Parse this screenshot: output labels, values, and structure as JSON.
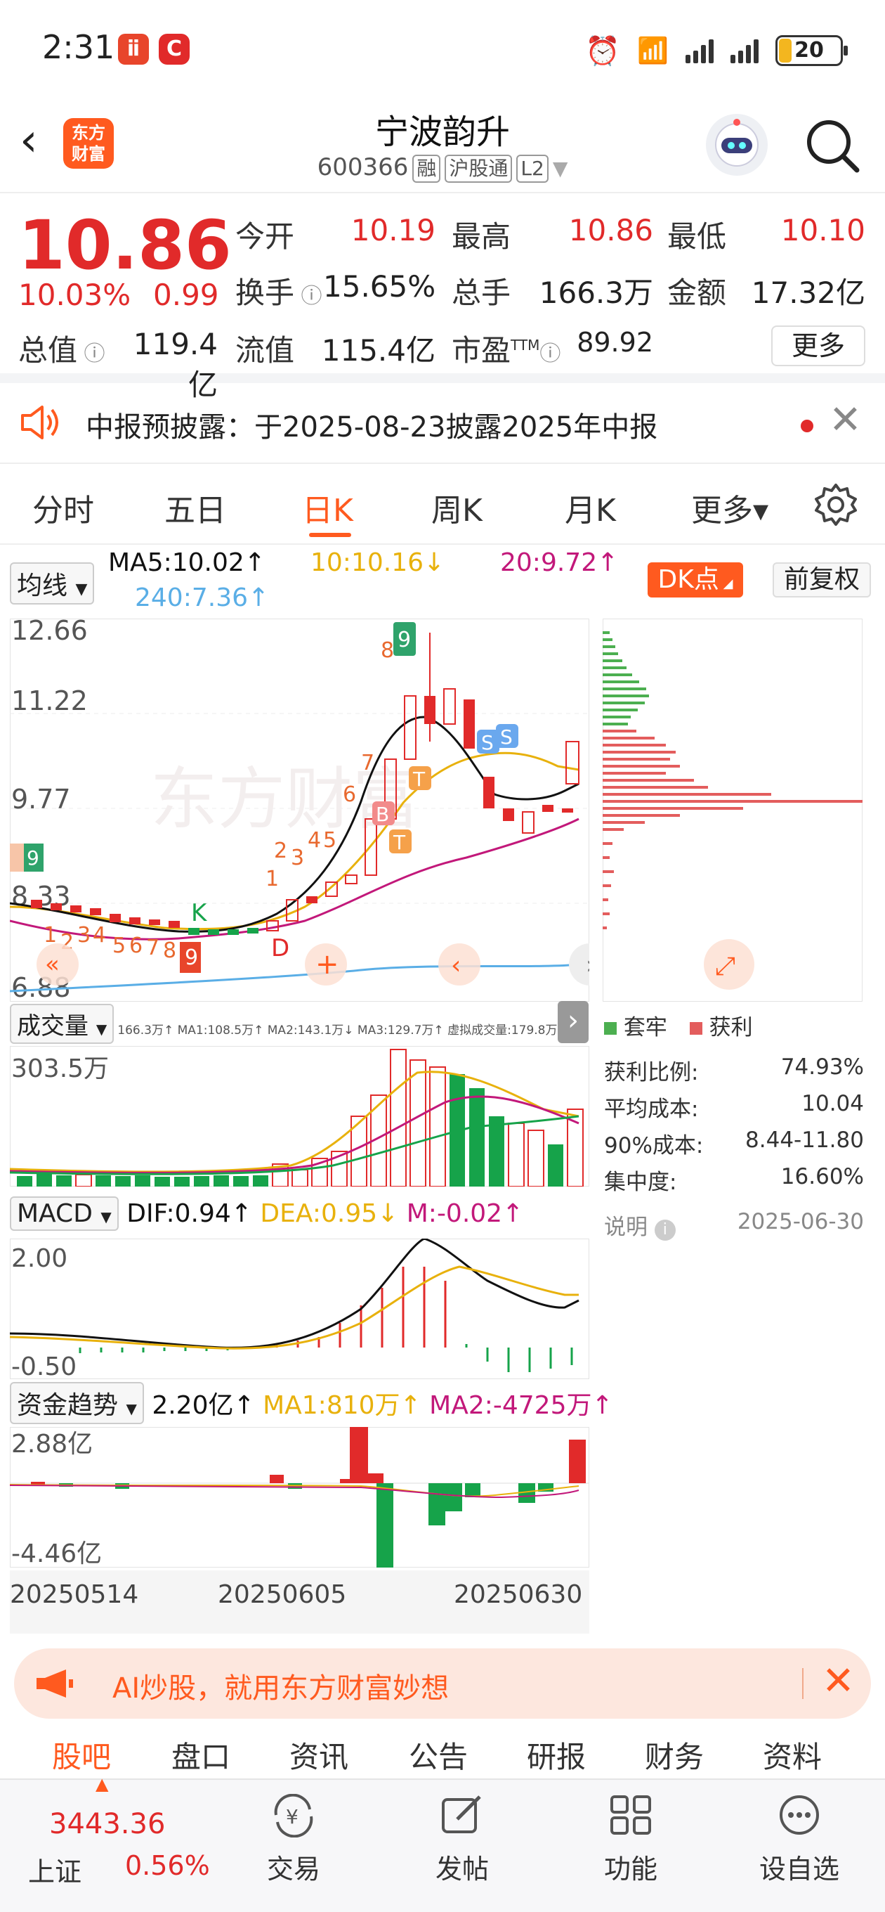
{
  "status": {
    "time": "2:31",
    "battery": "20"
  },
  "header": {
    "logo_line1": "东方",
    "logo_line2": "财富",
    "stock_name": "宁波韵升",
    "stock_code": "600366",
    "tags": [
      "融",
      "沪股通",
      "L2"
    ]
  },
  "quote": {
    "price": "10.86",
    "change_pct": "10.03%",
    "change": "0.99",
    "open_label": "今开",
    "open": "10.19",
    "high_label": "最高",
    "high": "10.86",
    "low_label": "最低",
    "low": "10.10",
    "turnover_label": "换手",
    "turnover": "15.65%",
    "volume_label": "总手",
    "volume": "166.3万",
    "amount_label": "金额",
    "amount": "17.32亿",
    "mktcap_label": "总值",
    "mktcap": "119.4亿",
    "float_label": "流值",
    "float": "115.4亿",
    "pe_label": "市盈",
    "pe_sup": "TTM",
    "pe": "89.92",
    "more_label": "更多"
  },
  "notice": {
    "text": "中报预披露：于2025-08-23披露2025年中报"
  },
  "tabs": [
    {
      "label": "分时"
    },
    {
      "label": "五日"
    },
    {
      "label": "日K"
    },
    {
      "label": "周K"
    },
    {
      "label": "月K"
    },
    {
      "label": "更多▾"
    }
  ],
  "ma": {
    "selector": "均线",
    "ma5": "MA5:10.02↑",
    "ma10": "10:10.16↓",
    "ma20": "20:9.72↑",
    "ma240": "240:7.36↑",
    "dk": "DK点",
    "adjust": "前复权"
  },
  "kchart": {
    "y_labels": [
      "12.66",
      "11.22",
      "9.77",
      "8.33",
      "6.88"
    ],
    "watermark": "东方财富",
    "markers": {
      "K": "K",
      "D": "D",
      "B": "B",
      "T": "T",
      "S": "S"
    }
  },
  "chips": {
    "legend_locked": "套牢",
    "legend_profit": "获利",
    "rows": [
      {
        "label": "获利比例:",
        "value": "74.93%"
      },
      {
        "label": "平均成本:",
        "value": "10.04"
      },
      {
        "label": "90%成本:",
        "value": "8.44-11.80"
      },
      {
        "label": "集中度:",
        "value": "16.60%"
      }
    ],
    "note_label": "说明",
    "date": "2025-06-30"
  },
  "volume": {
    "selector": "成交量",
    "legend": "166.3万↑ MA1:108.5万↑ MA2:143.1万↓ MA3:129.7万↑ 虚拟成交量:179.8万",
    "y_max": "303.5万"
  },
  "macd": {
    "selector": "MACD",
    "dif": "DIF:0.94↑",
    "dea": "DEA:0.95↓",
    "m": "M:-0.02↑",
    "y_max": "2.00",
    "y_min": "-0.50"
  },
  "fund": {
    "selector": "资金趋势",
    "value": "2.20亿↑",
    "ma1": "MA1:810万↑",
    "ma2": "MA2:-4725万↑",
    "y_max": "2.88亿",
    "y_min": "-4.46亿"
  },
  "dates": [
    "20250514",
    "20250605",
    "20250630"
  ],
  "ad": {
    "text": "AI炒股，就用东方财富妙想"
  },
  "sub_tabs": [
    "股吧",
    "盘口",
    "资讯",
    "公告",
    "研报",
    "财务",
    "资料"
  ],
  "bottom_nav": {
    "index_value": "3443.36",
    "index_name": "上证",
    "index_pct": "0.56%",
    "items": [
      {
        "label": "交易"
      },
      {
        "label": "发帖"
      },
      {
        "label": "功能"
      },
      {
        "label": "设自选"
      }
    ]
  },
  "colors": {
    "up": "#e12a2a",
    "down": "#16a34a",
    "accent": "#ff5a1f",
    "ma5": "#111111",
    "ma10": "#e8b10c",
    "ma20": "#c2187a",
    "ma240": "#5aaee6"
  }
}
